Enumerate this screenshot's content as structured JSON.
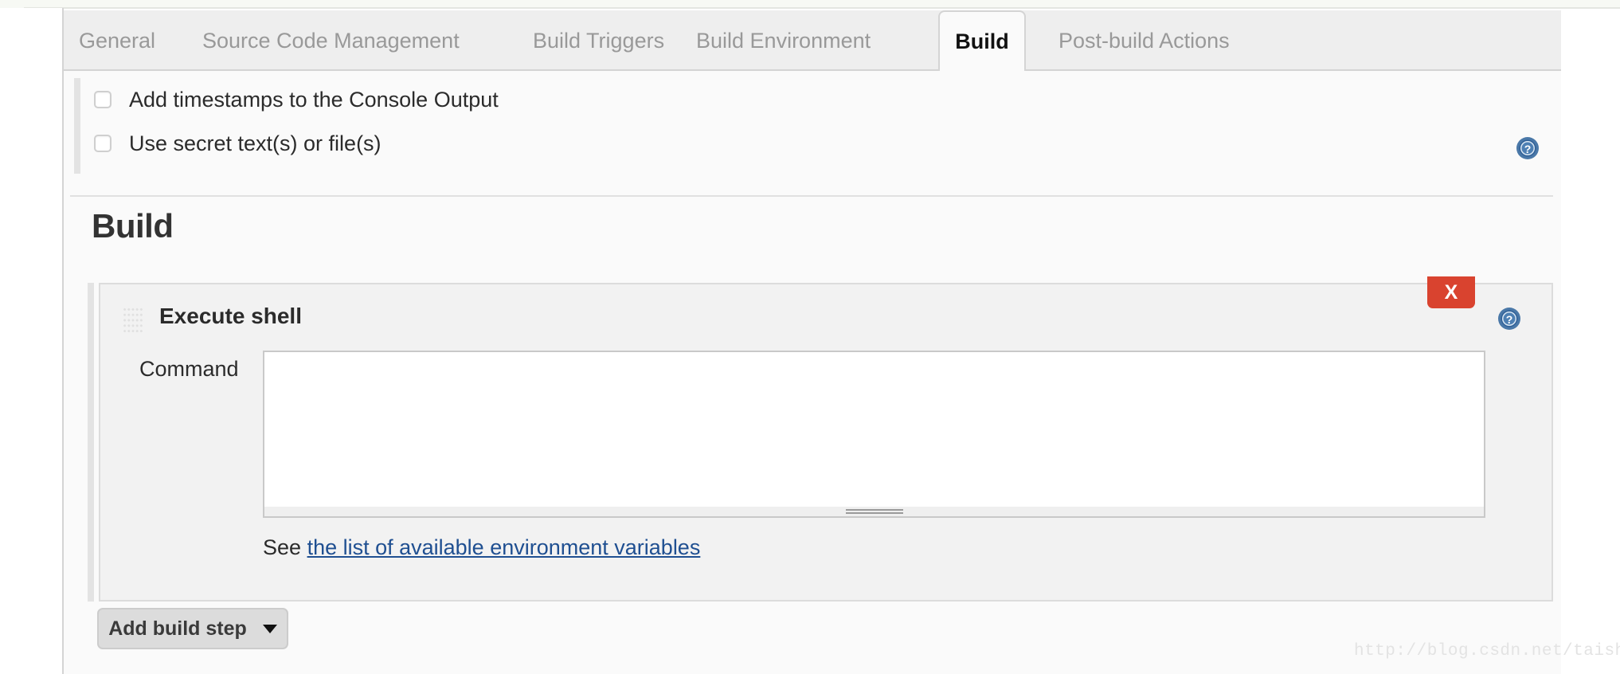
{
  "tabs": [
    {
      "label": "General",
      "active": false
    },
    {
      "label": "Source Code Management",
      "active": false
    },
    {
      "label": "Build Triggers",
      "active": false
    },
    {
      "label": "Build Environment",
      "active": false
    },
    {
      "label": "Build",
      "active": true
    },
    {
      "label": "Post-build Actions",
      "active": false
    }
  ],
  "build_environment": {
    "checkboxes": [
      {
        "label": "Add timestamps to the Console Output",
        "checked": false
      },
      {
        "label": "Use secret text(s) or file(s)",
        "checked": false
      }
    ],
    "help_icon": "help-icon"
  },
  "build_section": {
    "title": "Build",
    "step": {
      "title": "Execute shell",
      "drag_handle_icon": "drag-handle-icon",
      "delete_label": "X",
      "help_icon": "help-icon",
      "command_label": "Command",
      "command_value": "",
      "command_placeholder": "",
      "env_prefix": "See",
      "env_link": "the list of available environment variables"
    },
    "add_step_label": "Add build step",
    "add_step_caret": "chevron-down-icon"
  },
  "watermark": "http://blog.csdn.net/taishanduba",
  "colors": {
    "accent_link": "#1f4f91",
    "delete_red": "#d9432f",
    "help_blue": "#3a6ea5",
    "panel_bg": "#f2f2f2",
    "body_bg": "#fafafa",
    "tabbar_bg": "#eeeeee"
  }
}
